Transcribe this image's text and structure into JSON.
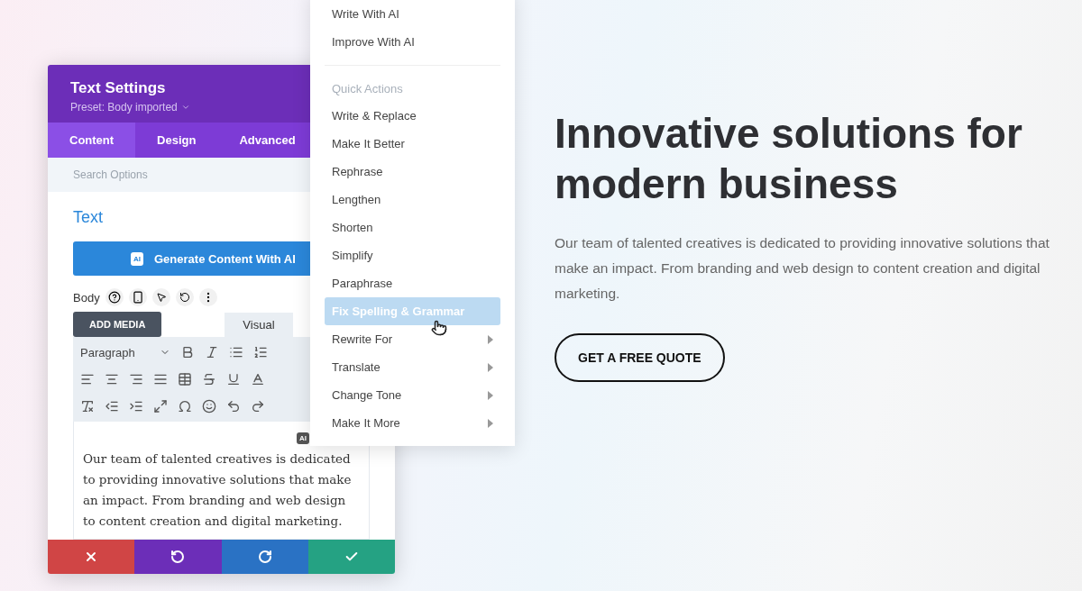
{
  "panel": {
    "title": "Text Settings",
    "preset": "Preset: Body imported",
    "tabs": [
      {
        "label": "Content",
        "selected": true
      },
      {
        "label": "Design",
        "selected": false
      },
      {
        "label": "Advanced",
        "selected": false
      }
    ],
    "search": {
      "placeholder": "Search Options"
    },
    "section_title": "Text",
    "generate_button": "Generate Content With AI",
    "ai_badge": "AI",
    "field_label": "Body",
    "add_media": "ADD MEDIA",
    "editor_tabs": [
      {
        "label": "Visual",
        "selected": true
      }
    ],
    "format_select": "Paragraph",
    "editor_ai_badge": "AI",
    "content": "Our team of talented creatives is dedicated to providing innovative solutions that make an impact. From branding and web design to content creation and digital marketing.",
    "footer": [
      {
        "kind": "cancel",
        "color": "#d04545"
      },
      {
        "kind": "undo",
        "color": "#6c2eb8"
      },
      {
        "kind": "redo",
        "color": "#2a72c4"
      },
      {
        "kind": "save",
        "color": "#25a283"
      }
    ]
  },
  "menu": [
    {
      "kind": "item",
      "label": "Write With AI",
      "selected": false
    },
    {
      "kind": "item",
      "label": "Improve With AI",
      "selected": false
    },
    {
      "kind": "divider"
    },
    {
      "kind": "header",
      "label": "Quick Actions"
    },
    {
      "kind": "item",
      "label": "Write & Replace",
      "selected": false
    },
    {
      "kind": "item",
      "label": "Make It Better",
      "selected": false
    },
    {
      "kind": "item",
      "label": "Rephrase",
      "selected": false
    },
    {
      "kind": "item",
      "label": "Lengthen",
      "selected": false
    },
    {
      "kind": "item",
      "label": "Shorten",
      "selected": false
    },
    {
      "kind": "item",
      "label": "Simplify",
      "selected": false
    },
    {
      "kind": "item",
      "label": "Paraphrase",
      "selected": false
    },
    {
      "kind": "item",
      "label": "Fix Spelling & Grammar",
      "selected": true
    },
    {
      "kind": "submenu",
      "label": "Rewrite For",
      "selected": false
    },
    {
      "kind": "submenu",
      "label": "Translate",
      "selected": false
    },
    {
      "kind": "submenu",
      "label": "Change Tone",
      "selected": false
    },
    {
      "kind": "submenu",
      "label": "Make It More",
      "selected": false
    }
  ],
  "hero": {
    "heading": "Innovative solutions for modern business",
    "text": "Our team of talented creatives is dedicated to providing innovative solutions that make an impact. From branding and web design to content creation and digital marketing.",
    "button": "GET A FREE QUOTE"
  }
}
